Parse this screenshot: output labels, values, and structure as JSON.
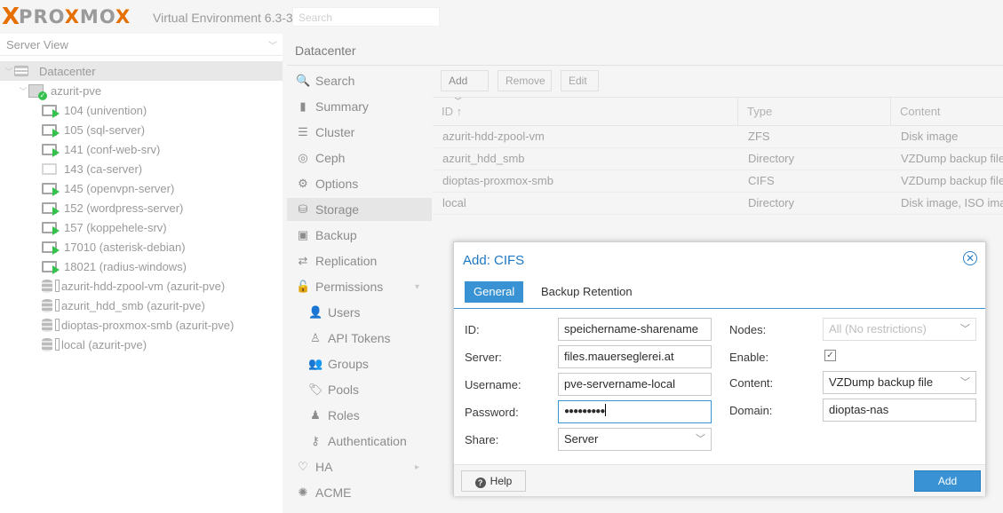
{
  "header": {
    "logo_x": "X",
    "logo_pro": "PRO",
    "logo_x2": "X",
    "logo_mo": "MO",
    "logo_x3": "X",
    "product": "Virtual Environment 6.3-3",
    "search_placeholder": "Search"
  },
  "sidebar": {
    "view_label": "Server View",
    "tree": [
      {
        "label": "Datacenter",
        "kind": "datacenter"
      },
      {
        "label": "azurit-pve",
        "kind": "node"
      },
      {
        "label": "104 (univention)",
        "kind": "vm-running"
      },
      {
        "label": "105 (sql-server)",
        "kind": "vm-running"
      },
      {
        "label": "141 (conf-web-srv)",
        "kind": "vm-running"
      },
      {
        "label": "143 (ca-server)",
        "kind": "vm-stopped"
      },
      {
        "label": "145 (openvpn-server)",
        "kind": "vm-running"
      },
      {
        "label": "152 (wordpress-server)",
        "kind": "vm-running"
      },
      {
        "label": "157 (koppehele-srv)",
        "kind": "vm-running"
      },
      {
        "label": "17010 (asterisk-debian)",
        "kind": "vm-running"
      },
      {
        "label": "18021 (radius-windows)",
        "kind": "vm-running"
      },
      {
        "label": "azurit-hdd-zpool-vm (azurit-pve)",
        "kind": "storage"
      },
      {
        "label": "azurit_hdd_smb (azurit-pve)",
        "kind": "storage"
      },
      {
        "label": "dioptas-proxmox-smb (azurit-pve)",
        "kind": "storage"
      },
      {
        "label": "local (azurit-pve)",
        "kind": "storage"
      }
    ]
  },
  "content": {
    "title": "Datacenter",
    "menu": [
      {
        "label": "Search",
        "icon": "search-icon"
      },
      {
        "label": "Summary",
        "icon": "book-icon"
      },
      {
        "label": "Cluster",
        "icon": "server-icon"
      },
      {
        "label": "Ceph",
        "icon": "ceph-icon"
      },
      {
        "label": "Options",
        "icon": "gear-icon"
      },
      {
        "label": "Storage",
        "icon": "database-icon"
      },
      {
        "label": "Backup",
        "icon": "floppy-icon"
      },
      {
        "label": "Replication",
        "icon": "retweet-icon"
      },
      {
        "label": "Permissions",
        "icon": "unlock-icon"
      },
      {
        "label": "Users",
        "icon": "user-icon"
      },
      {
        "label": "API Tokens",
        "icon": "user-outline-icon"
      },
      {
        "label": "Groups",
        "icon": "users-icon"
      },
      {
        "label": "Pools",
        "icon": "tags-icon"
      },
      {
        "label": "Roles",
        "icon": "male-icon"
      },
      {
        "label": "Authentication",
        "icon": "key-icon"
      },
      {
        "label": "HA",
        "icon": "heartbeat-icon"
      },
      {
        "label": "ACME",
        "icon": "certificate-icon"
      }
    ],
    "toolbar": {
      "add": "Add",
      "remove": "Remove",
      "edit": "Edit"
    },
    "columns": [
      "ID ↑",
      "Type",
      "Content"
    ],
    "rows": [
      {
        "id": "azurit-hdd-zpool-vm",
        "type": "ZFS",
        "content": "Disk image"
      },
      {
        "id": "azurit_hdd_smb",
        "type": "Directory",
        "content": "VZDump backup file"
      },
      {
        "id": "dioptas-proxmox-smb",
        "type": "CIFS",
        "content": "VZDump backup file"
      },
      {
        "id": "local",
        "type": "Directory",
        "content": "Disk image, ISO image"
      }
    ]
  },
  "dialog": {
    "title": "Add: CIFS",
    "tabs": [
      "General",
      "Backup Retention"
    ],
    "fields": {
      "id_label": "ID:",
      "id_value": "speichername-sharename",
      "server_label": "Server:",
      "server_value": "files.mauerseglerei.at",
      "username_label": "Username:",
      "username_value": "pve-servername-local",
      "password_label": "Password:",
      "password_value": "●●●●●●●●●",
      "share_label": "Share:",
      "share_value": "Server",
      "nodes_label": "Nodes:",
      "nodes_value": "All (No restrictions)",
      "enable_label": "Enable:",
      "enable_checked": true,
      "content_label": "Content:",
      "content_value": "VZDump backup file",
      "domain_label": "Domain:",
      "domain_value": "dioptas-nas"
    },
    "help": "Help",
    "add": "Add"
  }
}
